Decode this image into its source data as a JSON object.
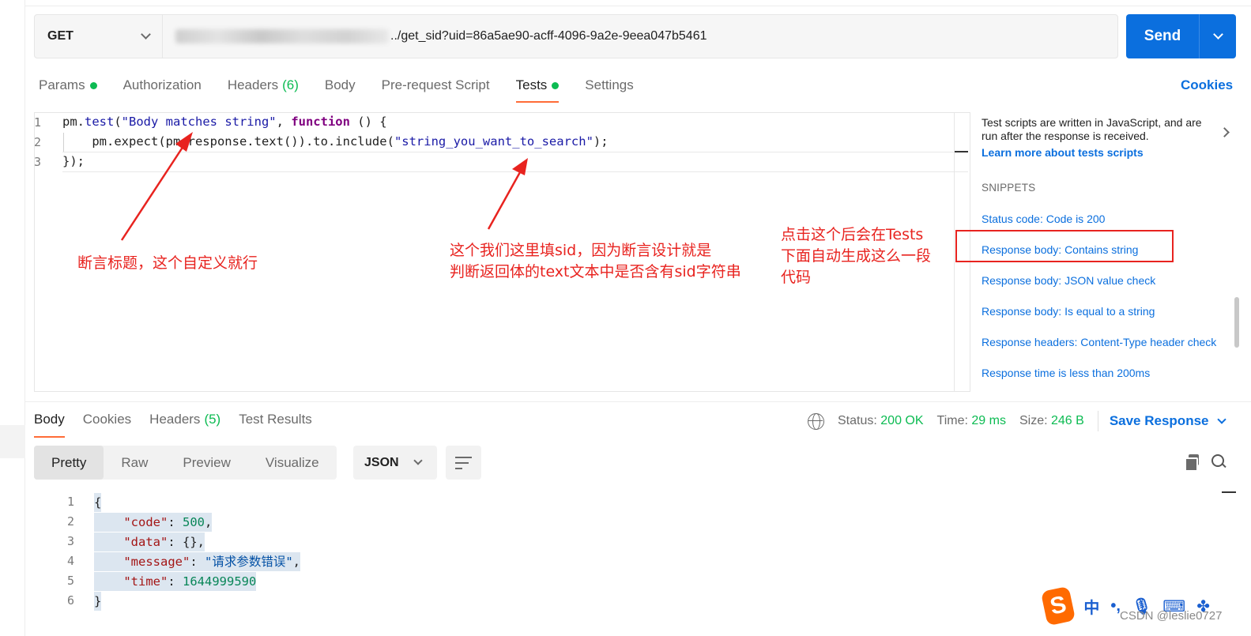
{
  "request": {
    "method": "GET",
    "url_visible": "../get_sid?uid=86a5ae90-acff-4096-9a2e-9eea047b5461",
    "send_label": "Send"
  },
  "request_tabs": [
    {
      "label": "Params",
      "dot": true
    },
    {
      "label": "Authorization"
    },
    {
      "label": "Headers",
      "count": "(6)"
    },
    {
      "label": "Body"
    },
    {
      "label": "Pre-request Script"
    },
    {
      "label": "Tests",
      "dot": true,
      "active": true
    },
    {
      "label": "Settings"
    }
  ],
  "cookies_label": "Cookies",
  "editor": {
    "line_numbers": [
      "1",
      "2",
      "3"
    ]
  },
  "side_panel": {
    "description": "Test scripts are written in JavaScript, and are run after the response is received.",
    "learn_more": "Learn more about tests scripts",
    "snippets_heading": "SNIPPETS",
    "snippets": [
      "Status code: Code is 200",
      "Response body: Contains string",
      "Response body: JSON value check",
      "Response body: Is equal to a string",
      "Response headers: Content-Type header check",
      "Response time is less than 200ms"
    ]
  },
  "response": {
    "tabs": [
      "Body",
      "Cookies",
      "Headers",
      "Test Results"
    ],
    "headers_count": "(5)",
    "status_label": "Status:",
    "status_value": "200 OK",
    "time_label": "Time:",
    "time_value": "29 ms",
    "size_label": "Size:",
    "size_value": "246 B",
    "save_label": "Save Response",
    "view_modes": [
      "Pretty",
      "Raw",
      "Preview",
      "Visualize"
    ],
    "format": "JSON",
    "line_numbers": [
      "1",
      "2",
      "3",
      "4",
      "5",
      "6"
    ],
    "json": {
      "code_key": "\"code\"",
      "code_val": "500",
      "data_key": "\"data\"",
      "data_val": "{}",
      "message_key": "\"message\"",
      "message_val": "\"请求参数错误\"",
      "time_key": "\"time\"",
      "time_val": "1644999590"
    }
  },
  "annotations": {
    "title_note": "断言标题，这个自定义就行",
    "sid_note_line1": "这个我们这里填sid，因为断言设计就是",
    "sid_note_line2": "判断返回体的text文本中是否含有sid字符串",
    "click_note_line1": "点击这个后会在Tests",
    "click_note_line2": "下面自动生成这么一段",
    "click_note_line3": "代码"
  },
  "ime": {
    "logo": "S",
    "label": "中"
  },
  "watermark": "CSDN @leslie0727",
  "colors": {
    "accent_blue": "#0b6fde",
    "active_tab": "#ff6c37",
    "success_green": "#0cbb52",
    "annotation_red": "#e8231f"
  }
}
